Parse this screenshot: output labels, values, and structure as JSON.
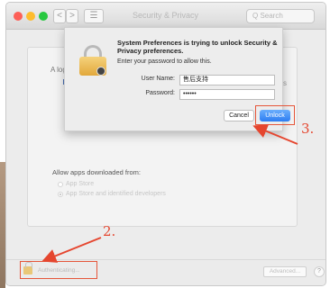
{
  "window": {
    "title": "Security & Privacy",
    "search_placeholder": "Q Search",
    "nav_back": "<",
    "nav_forward": ">",
    "grid_icon": "☰"
  },
  "pane": {
    "general_text": "A log",
    "right_text": "s"
  },
  "gatekeeper": {
    "label": "Allow apps downloaded from:",
    "options": [
      {
        "label": "App Store",
        "selected": false
      },
      {
        "label": "App Store and identified developers",
        "selected": true
      }
    ]
  },
  "dialog": {
    "title": "System Preferences is trying to unlock Security & Privacy preferences.",
    "subtitle": "Enter your password to allow this.",
    "username_label": "User Name:",
    "username_value": "售后支持",
    "password_label": "Password:",
    "password_value": "••••••",
    "cancel_label": "Cancel",
    "unlock_label": "Unlock"
  },
  "bottom": {
    "auth_text": "Authenticating...",
    "advanced_label": "Advanced...",
    "help_label": "?"
  },
  "annotations": {
    "step2": "2.",
    "step3": "3.",
    "color": "#e5462f"
  }
}
